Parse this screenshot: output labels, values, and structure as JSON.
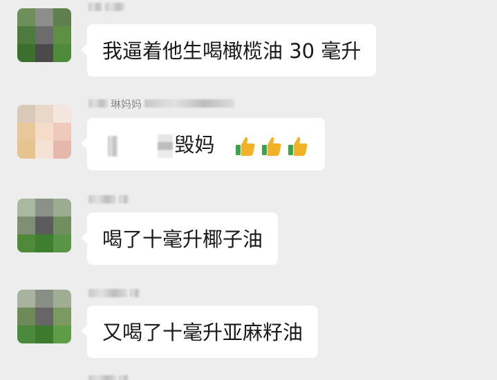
{
  "messages": [
    {
      "sender_name": "",
      "text": "我逼着他生喝橄榄油 30 毫升"
    },
    {
      "sender_name": "琳妈妈",
      "text_visible": "毁妈",
      "emoji": [
        "thumbs-up-icon",
        "thumbs-up-icon",
        "thumbs-up-icon"
      ]
    },
    {
      "sender_name": "",
      "text": "喝了十毫升椰子油"
    },
    {
      "sender_name": "",
      "text": "又喝了十毫升亚麻籽油"
    }
  ],
  "colors": {
    "background": "#ededed",
    "bubble": "#ffffff",
    "text": "#1a1a1a",
    "sender": "#9a9a9a",
    "thumb_yellow": "#f2b227",
    "thumb_green": "#3aa54a"
  }
}
